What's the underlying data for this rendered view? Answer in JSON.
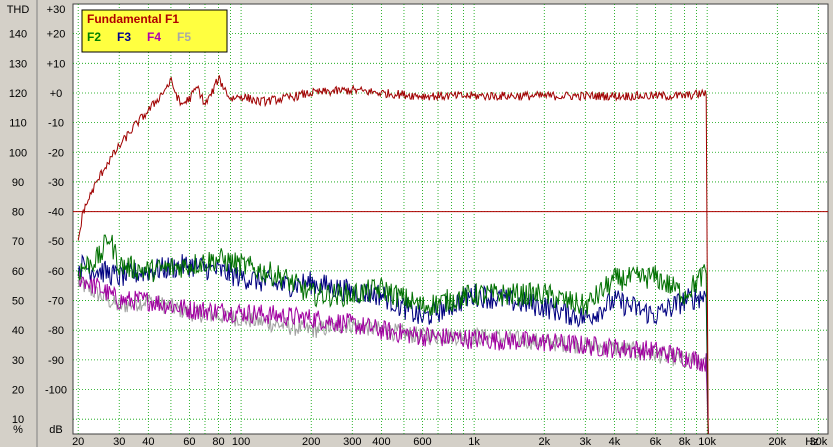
{
  "chart_data": {
    "type": "line",
    "scale_x": "log",
    "xlim": [
      19,
      33000
    ],
    "ylim": [
      -115,
      30
    ],
    "thd_scale_headers": {
      "label": "THD",
      "unit": "%"
    },
    "db_scale_headers": {
      "label": "+30",
      "unit": "dB"
    },
    "x_tick_labels": [
      {
        "v": 20,
        "t": "20"
      },
      {
        "v": 30,
        "t": "30"
      },
      {
        "v": 40,
        "t": "40"
      },
      {
        "v": 60,
        "t": "60"
      },
      {
        "v": 80,
        "t": "80"
      },
      {
        "v": 100,
        "t": "100"
      },
      {
        "v": 200,
        "t": "200"
      },
      {
        "v": 300,
        "t": "300"
      },
      {
        "v": 400,
        "t": "400"
      },
      {
        "v": 600,
        "t": "600"
      },
      {
        "v": 1000,
        "t": "1k"
      },
      {
        "v": 2000,
        "t": "2k"
      },
      {
        "v": 3000,
        "t": "3k"
      },
      {
        "v": 4000,
        "t": "4k"
      },
      {
        "v": 6000,
        "t": "6k"
      },
      {
        "v": 8000,
        "t": "8k"
      },
      {
        "v": 10000,
        "t": "10k"
      },
      {
        "v": 20000,
        "t": "20k"
      },
      {
        "v": 30000,
        "t": "30k"
      }
    ],
    "x_unit_label": "Hz",
    "db_tick_labels": [
      {
        "v": 20,
        "t": "+20"
      },
      {
        "v": 10,
        "t": "+10"
      },
      {
        "v": 0,
        "t": "+0"
      },
      {
        "v": -10,
        "t": "-10"
      },
      {
        "v": -20,
        "t": "-20"
      },
      {
        "v": -30,
        "t": "-30"
      },
      {
        "v": -40,
        "t": "-40"
      },
      {
        "v": -50,
        "t": "-50"
      },
      {
        "v": -60,
        "t": "-60"
      },
      {
        "v": -70,
        "t": "-70"
      },
      {
        "v": -80,
        "t": "-80"
      },
      {
        "v": -90,
        "t": "-90"
      },
      {
        "v": -100,
        "t": "-100"
      }
    ],
    "thd_tick_labels": [
      {
        "v": 20,
        "t": "140"
      },
      {
        "v": 10,
        "t": "130"
      },
      {
        "v": 0,
        "t": "120"
      },
      {
        "v": -10,
        "t": "110"
      },
      {
        "v": -20,
        "t": "100"
      },
      {
        "v": -30,
        "t": "90"
      },
      {
        "v": -40,
        "t": "80"
      },
      {
        "v": -50,
        "t": "70"
      },
      {
        "v": -60,
        "t": "60"
      },
      {
        "v": -70,
        "t": "50"
      },
      {
        "v": -80,
        "t": "40"
      },
      {
        "v": -90,
        "t": "30"
      },
      {
        "v": -100,
        "t": "20"
      },
      {
        "v": -110,
        "t": "10"
      }
    ],
    "reference_line_db": -40,
    "legend": [
      {
        "name": "Fundamental F1",
        "color": "#b00000"
      },
      {
        "name": "F2",
        "color": "#008000"
      },
      {
        "name": "F3",
        "color": "#000090"
      },
      {
        "name": "F4",
        "color": "#b000b0"
      },
      {
        "name": "F5",
        "color": "#a8a8a8"
      }
    ],
    "series": [
      {
        "name": "Fundamental F1",
        "color": "#a00000",
        "points": [
          [
            20,
            -50
          ],
          [
            21,
            -40
          ],
          [
            23,
            -33
          ],
          [
            26,
            -25
          ],
          [
            30,
            -18
          ],
          [
            35,
            -11
          ],
          [
            40,
            -6
          ],
          [
            45,
            -1
          ],
          [
            50,
            4
          ],
          [
            55,
            -4
          ],
          [
            60,
            -2
          ],
          [
            65,
            2
          ],
          [
            70,
            -4
          ],
          [
            75,
            0
          ],
          [
            80,
            5
          ],
          [
            90,
            -2
          ],
          [
            100,
            -1
          ],
          [
            120,
            -3
          ],
          [
            150,
            -2
          ],
          [
            200,
            0
          ],
          [
            300,
            1
          ],
          [
            400,
            0
          ],
          [
            600,
            -1
          ],
          [
            1000,
            -1
          ],
          [
            2000,
            -1
          ],
          [
            4000,
            -1
          ],
          [
            6000,
            -1
          ],
          [
            8000,
            -1
          ],
          [
            10000,
            0
          ]
        ],
        "annotation": "falls to about -115 dB just above 10k"
      },
      {
        "name": "F2",
        "color": "#007000",
        "points": [
          [
            20,
            -60
          ],
          [
            25,
            -55
          ],
          [
            27,
            -48
          ],
          [
            30,
            -58
          ],
          [
            40,
            -60
          ],
          [
            60,
            -58
          ],
          [
            80,
            -56
          ],
          [
            100,
            -58
          ],
          [
            150,
            -62
          ],
          [
            200,
            -68
          ],
          [
            300,
            -68
          ],
          [
            400,
            -66
          ],
          [
            600,
            -72
          ],
          [
            1000,
            -68
          ],
          [
            2000,
            -68
          ],
          [
            3000,
            -72
          ],
          [
            4000,
            -63
          ],
          [
            6000,
            -62
          ],
          [
            8000,
            -68
          ],
          [
            10000,
            -60
          ]
        ]
      },
      {
        "name": "F3",
        "color": "#000080",
        "points": [
          [
            20,
            -58
          ],
          [
            25,
            -60
          ],
          [
            30,
            -62
          ],
          [
            40,
            -60
          ],
          [
            60,
            -58
          ],
          [
            80,
            -60
          ],
          [
            100,
            -62
          ],
          [
            150,
            -65
          ],
          [
            200,
            -64
          ],
          [
            300,
            -67
          ],
          [
            400,
            -68
          ],
          [
            600,
            -76
          ],
          [
            1000,
            -68
          ],
          [
            2000,
            -72
          ],
          [
            3000,
            -76
          ],
          [
            4000,
            -70
          ],
          [
            6000,
            -75
          ],
          [
            8000,
            -70
          ],
          [
            10000,
            -68
          ]
        ]
      },
      {
        "name": "F4",
        "color": "#a000a0",
        "points": [
          [
            20,
            -62
          ],
          [
            25,
            -66
          ],
          [
            30,
            -70
          ],
          [
            40,
            -70
          ],
          [
            60,
            -73
          ],
          [
            100,
            -74
          ],
          [
            200,
            -76
          ],
          [
            300,
            -78
          ],
          [
            400,
            -80
          ],
          [
            600,
            -82
          ],
          [
            1000,
            -83
          ],
          [
            2000,
            -84
          ],
          [
            4000,
            -86
          ],
          [
            6000,
            -87
          ],
          [
            8000,
            -89
          ],
          [
            10000,
            -91
          ]
        ]
      },
      {
        "name": "F5",
        "color": "#a0a0a0",
        "points": [
          [
            20,
            -64
          ],
          [
            30,
            -72
          ],
          [
            40,
            -70
          ],
          [
            60,
            -74
          ],
          [
            100,
            -76
          ],
          [
            200,
            -80
          ],
          [
            300,
            -78
          ],
          [
            400,
            -80
          ],
          [
            600,
            -82
          ],
          [
            1000,
            -82
          ],
          [
            2000,
            -84
          ],
          [
            4000,
            -86
          ],
          [
            6000,
            -88
          ],
          [
            8000,
            -90
          ],
          [
            10000,
            -92
          ]
        ]
      }
    ]
  }
}
